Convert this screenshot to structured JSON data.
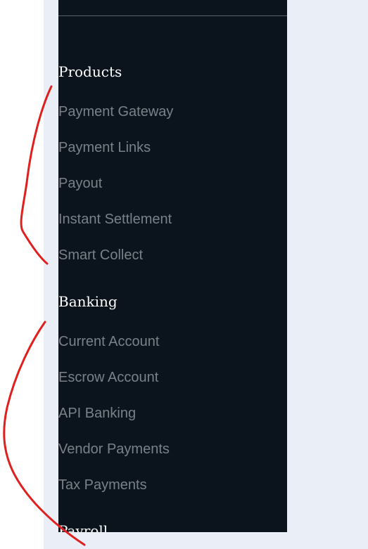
{
  "sections": [
    {
      "heading": "Products",
      "items": [
        "Payment Gateway",
        "Payment Links",
        "Payout",
        "Instant Settlement",
        "Smart Collect"
      ]
    },
    {
      "heading": "Banking",
      "items": [
        "Current Account",
        "Escrow Account",
        "API Banking",
        "Vendor Payments",
        "Tax Payments"
      ]
    },
    {
      "heading": "Payroll",
      "items": []
    }
  ],
  "colors": {
    "panel_background": "#0b141d",
    "heading_text": "#ffffff",
    "link_text": "#7a8087",
    "page_background": "#e9eef7",
    "annotation_ink": "#e0201e"
  }
}
